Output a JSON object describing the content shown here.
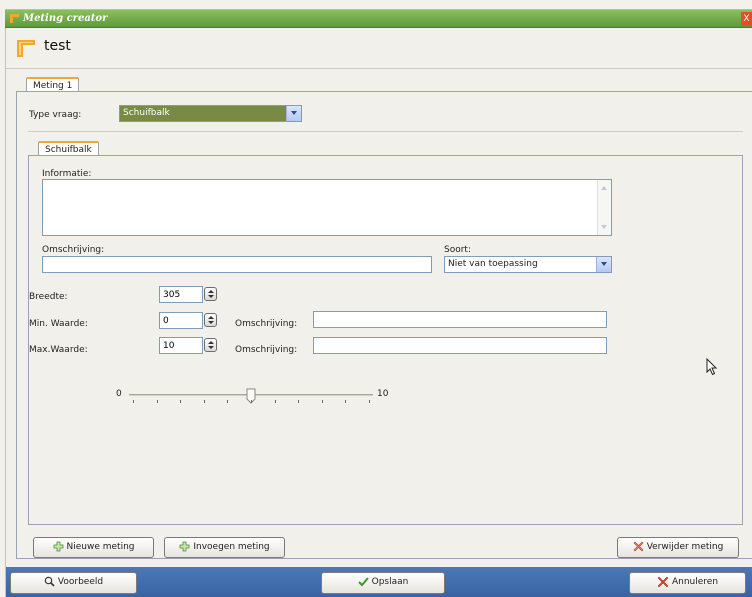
{
  "window": {
    "title": "Meting creator",
    "close_symbol": "X",
    "header_title": "test"
  },
  "tabs": {
    "meting": "Meting 1",
    "schuifbalk": "Schuifbalk"
  },
  "type_vraag": {
    "label": "Type vraag:",
    "value": "Schuifbalk"
  },
  "form": {
    "informatie_label": "Informatie:",
    "informatie_value": "",
    "omschrijving_label": "Omschrijving:",
    "omschrijving_value": "",
    "soort_label": "Soort:",
    "soort_value": "Niet van toepassing",
    "breedte_label": "Breedte:",
    "breedte_value": "305",
    "min_label": "Min. Waarde:",
    "min_value": "0",
    "max_label": "Max.Waarde:",
    "max_value": "10",
    "min_omschrijving_label": "Omschrijving:",
    "min_omschrijving_value": "",
    "max_omschrijving_label": "Omschrijving:",
    "max_omschrijving_value": ""
  },
  "slider": {
    "min_label": "0",
    "max_label": "10",
    "value_fraction": 0.5,
    "tick_count": 11
  },
  "buttons": {
    "nieuwe_meting": "Nieuwe meting",
    "invoegen_meting": "Invoegen meting",
    "verwijder_meting": "Verwijder meting",
    "voorbeeld": "Voorbeeld",
    "opslaan": "Opslaan",
    "annuleren": "Annuleren"
  },
  "colors": {
    "titlebar": "#6aa544",
    "accent_tab": "#f0a830",
    "bottom_bar": "#4470b0",
    "type_select_bg": "#7a8a45"
  }
}
